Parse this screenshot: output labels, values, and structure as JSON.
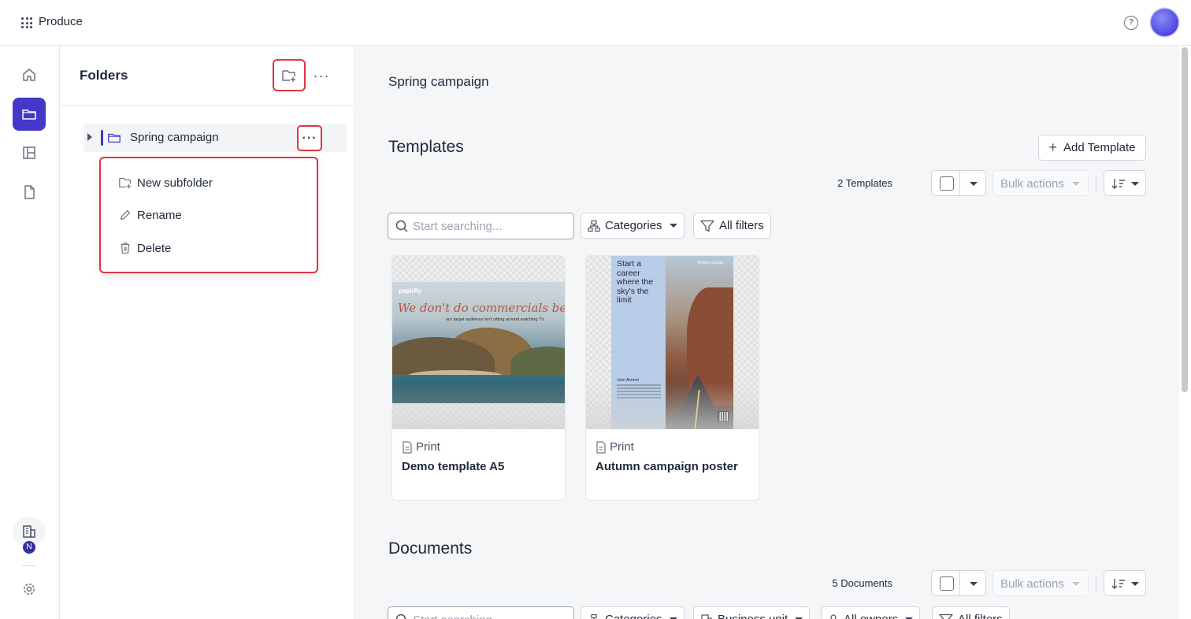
{
  "app": {
    "name": "Produce"
  },
  "folders_panel": {
    "title": "Folders",
    "tree": [
      {
        "label": "Spring campaign"
      }
    ],
    "context_menu": [
      {
        "label": "New subfolder",
        "icon": "folder-plus-icon"
      },
      {
        "label": "Rename",
        "icon": "pencil-icon"
      },
      {
        "label": "Delete",
        "icon": "trash-icon"
      }
    ]
  },
  "rail": {
    "org_badge": "N"
  },
  "main": {
    "folder_title": "Spring campaign",
    "templates": {
      "title": "Templates",
      "add_label": "Add Template",
      "count_label": "2 Templates",
      "bulk_label": "Bulk actions",
      "search_placeholder": "Start searching...",
      "categories_label": "Categories",
      "all_filters_label": "All filters",
      "cards": [
        {
          "kind": "Print",
          "name": "Demo template A5",
          "art": {
            "logo": "papirfly",
            "headline": "We don't do commercials because...",
            "sub": "our target audience isn't sitting around watching TV."
          }
        },
        {
          "kind": "Print",
          "name": "Autumn campaign poster",
          "art": {
            "headline": "Start a career where the sky's the limit",
            "brand": "Fortex Group",
            "person": "John Ahmed"
          }
        }
      ]
    },
    "documents": {
      "title": "Documents",
      "count_label": "5 Documents",
      "bulk_label": "Bulk actions",
      "search_placeholder": "Start searching...",
      "categories_label": "Categories",
      "business_unit_label": "Business unit",
      "owners_label": "All owners",
      "all_filters_label": "All filters"
    }
  },
  "colors": {
    "accent": "#4338ca",
    "highlight": "#dc3545"
  }
}
